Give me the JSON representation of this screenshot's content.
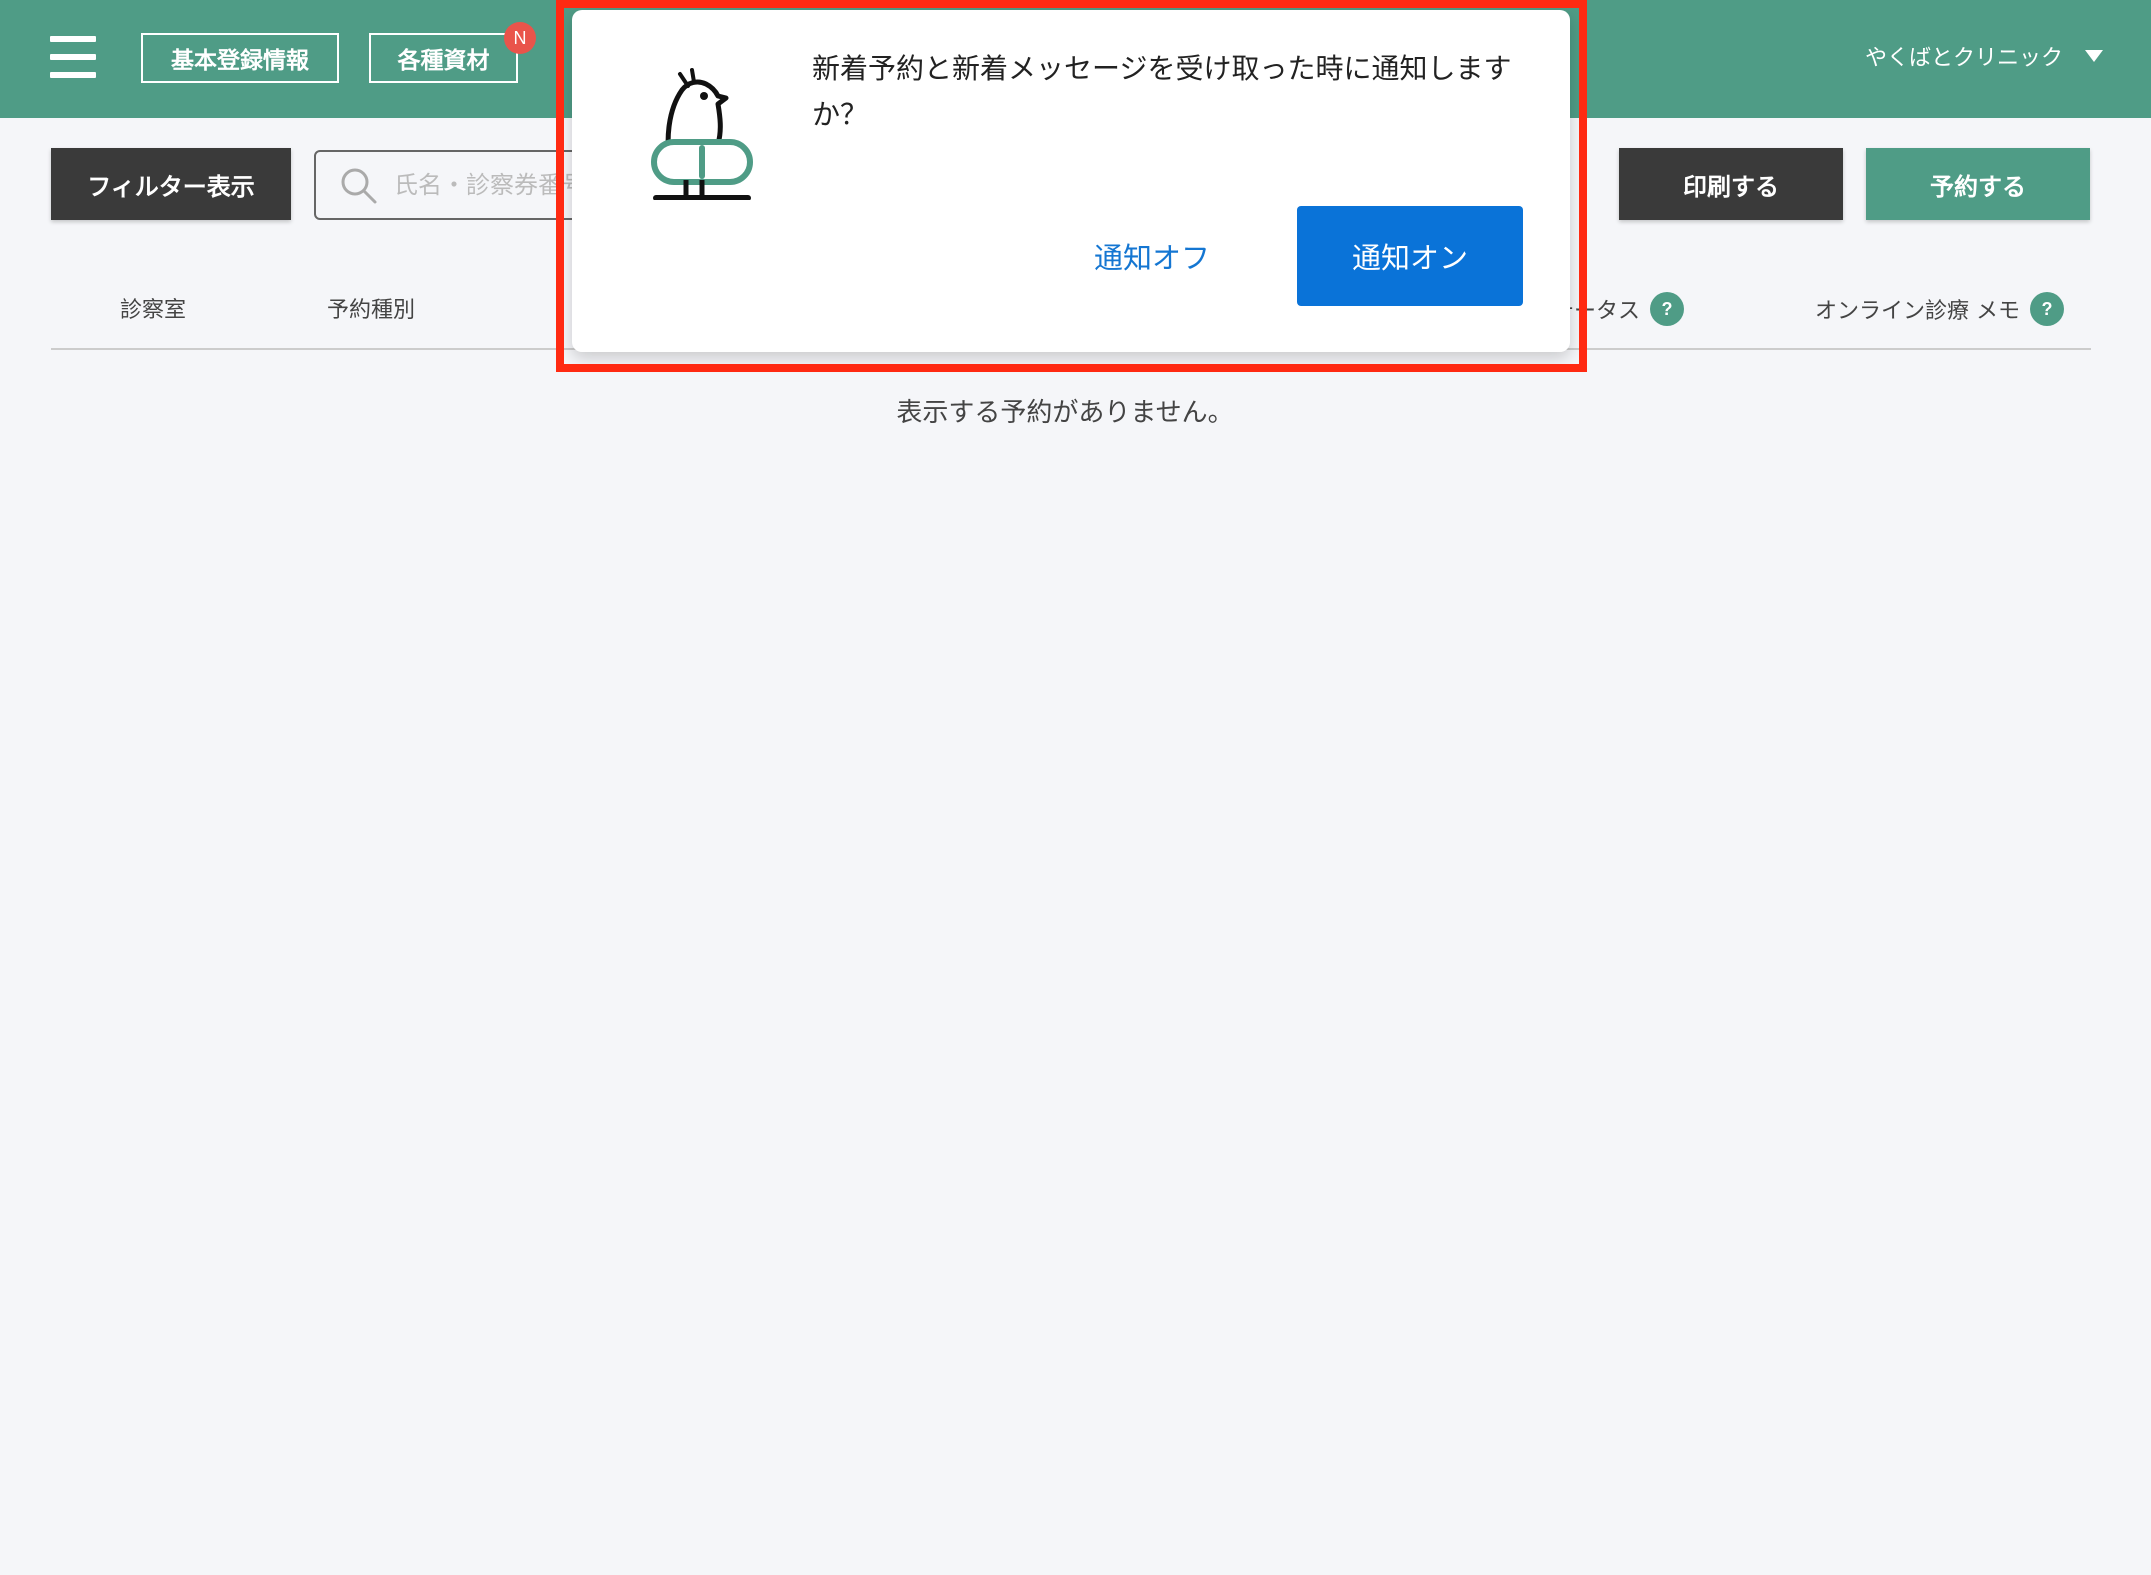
{
  "header": {
    "buttons": [
      {
        "label": "基本登録情報"
      },
      {
        "label": "各種資材",
        "badge": "N"
      }
    ],
    "clinic_name": "やくばとクリニック",
    "bg_color": "#4f9c86"
  },
  "toolbar": {
    "filter_label": "フィルター表示",
    "search_placeholder": "氏名・診察券番号",
    "print_label": "印刷する",
    "reserve_label": "予約する"
  },
  "table": {
    "columns": [
      {
        "label": "診察室",
        "help": false
      },
      {
        "label": "予約種別",
        "help": false
      },
      {
        "label": "ステータス",
        "help": true
      },
      {
        "label": "オンライン診療 メモ",
        "help": true
      }
    ],
    "help_glyph": "?",
    "empty_message": "表示する予約がありません。"
  },
  "dialog": {
    "message": "新着予約と新着メッセージを受け取った時に通知しますか？",
    "off_label": "通知オフ",
    "on_label": "通知オン",
    "icon": "bird-on-pill-logo"
  },
  "colors": {
    "brand": "#4f9c86",
    "primary_button": "#0a73d8",
    "highlight": "#ff2a12",
    "badge": "#e9544b"
  }
}
